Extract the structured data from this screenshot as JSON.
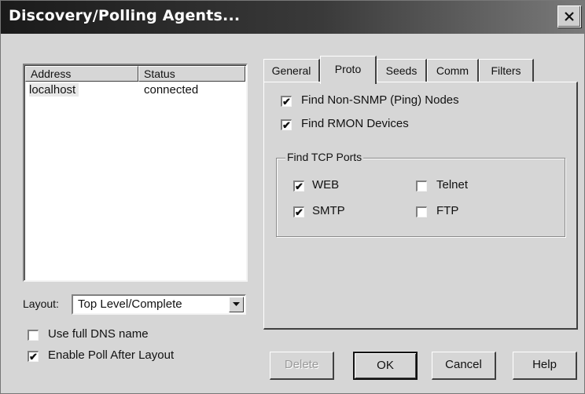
{
  "window": {
    "title": "Discovery/Polling Agents..."
  },
  "agents_list": {
    "columns": [
      "Address",
      "Status"
    ],
    "rows": [
      {
        "address": "localhost",
        "status": "connected"
      }
    ]
  },
  "layout": {
    "label": "Layout:",
    "value": "Top Level/Complete"
  },
  "options": {
    "use_full_dns": {
      "label": "Use full DNS name",
      "checked": false
    },
    "enable_poll": {
      "label": "Enable Poll After Layout",
      "checked": true
    }
  },
  "tabs": [
    {
      "label": "General",
      "active": false
    },
    {
      "label": "Proto",
      "active": true
    },
    {
      "label": "Seeds",
      "active": false
    },
    {
      "label": "Comm",
      "active": false
    },
    {
      "label": "Filters",
      "active": false
    }
  ],
  "proto": {
    "find_non_snmp": {
      "label": "Find Non-SNMP (Ping) Nodes",
      "checked": true
    },
    "find_rmon": {
      "label": "Find RMON Devices",
      "checked": true
    },
    "tcp_group_title": "Find TCP Ports",
    "ports": {
      "web": {
        "label": "WEB",
        "checked": true
      },
      "smtp": {
        "label": "SMTP",
        "checked": true
      },
      "telnet": {
        "label": "Telnet",
        "checked": false
      },
      "ftp": {
        "label": "FTP",
        "checked": false
      }
    }
  },
  "buttons": {
    "delete": "Delete",
    "ok": "OK",
    "cancel": "Cancel",
    "help": "Help"
  },
  "check_mark": "✔"
}
